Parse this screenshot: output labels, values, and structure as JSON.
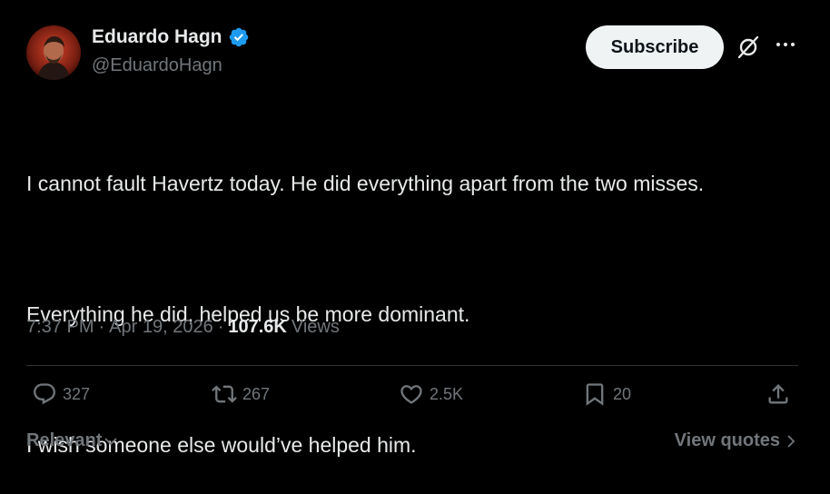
{
  "author": {
    "name": "Eduardo Hagn",
    "handle": "@EduardoHagn",
    "verified": true
  },
  "header": {
    "subscribe_label": "Subscribe",
    "icons": [
      "grok-icon",
      "more-icon"
    ]
  },
  "tweet": {
    "paragraphs": [
      "I cannot fault Havertz today. He did everything apart from the two misses.",
      "Everything he did, helped us be more dominant.",
      "I wish someone else would’ve helped him."
    ]
  },
  "meta": {
    "time": "7:37 PM",
    "separator": "·",
    "date": "Apr 19, 2026",
    "views_count": "107.6K",
    "views_label": "Views"
  },
  "actions": {
    "replies": "327",
    "reposts": "267",
    "likes": "2.5K",
    "bookmarks": "20"
  },
  "footer": {
    "sort_label": "Relevant",
    "quotes_label": "View quotes"
  },
  "colors": {
    "background": "#000000",
    "text_primary": "#e7e9ea",
    "text_secondary": "#71767b",
    "verified_blue": "#1d9bf0",
    "divider": "#2f3336"
  }
}
